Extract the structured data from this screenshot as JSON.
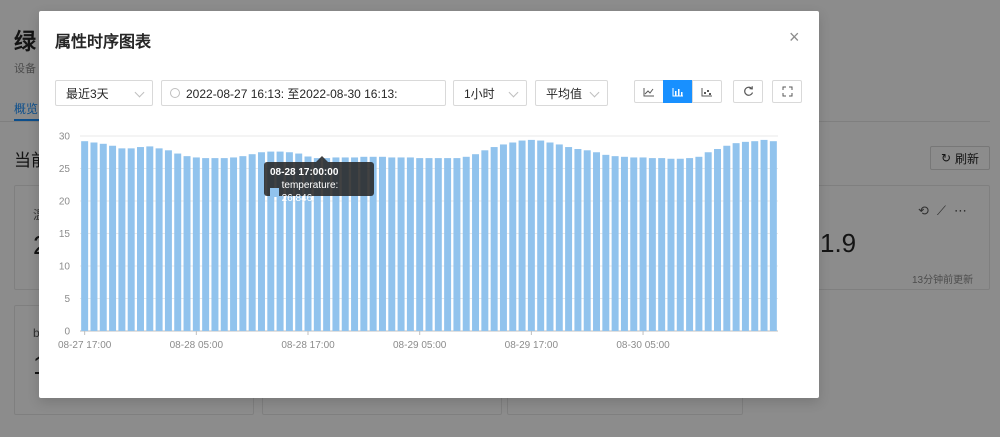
{
  "background": {
    "title": "绿",
    "subtitle": "设备",
    "tab": "概览",
    "section_title": "当前",
    "refresh_label": "刷新",
    "card1_label": "温",
    "card1_value": "2",
    "card2_label": "b",
    "card2_value": "1",
    "right_value": "1.9",
    "right_time": "13分钟前更新"
  },
  "modal": {
    "title": "属性时序图表",
    "close": "×",
    "time_range": "最近3天",
    "date_range": "2022-08-27 16:13:  至2022-08-30 16:13:",
    "interval": "1小时",
    "aggregation": "平均值",
    "chart_types": [
      "line-chart-icon",
      "bar-chart-icon",
      "table-chart-icon"
    ],
    "active_chart_type": "bar-chart-icon"
  },
  "tooltip": {
    "title": "08-28 17:00:00",
    "series": "temperature",
    "value": "26.846",
    "text": "temperature: 26.846"
  },
  "chart_data": {
    "type": "bar",
    "bar_color": "#91c3ed",
    "ylim": [
      0,
      30
    ],
    "yticks": [
      0,
      5,
      10,
      15,
      20,
      25,
      30
    ],
    "x_tick_labels": [
      "08-27 17:00",
      "08-28 05:00",
      "08-28 17:00",
      "08-29 05:00",
      "08-29 17:00",
      "08-30 05:00"
    ],
    "x_tick_every": 12,
    "series": [
      {
        "name": "temperature",
        "values": [
          29.2,
          29.0,
          28.8,
          28.5,
          28.1,
          28.1,
          28.3,
          28.4,
          28.1,
          27.8,
          27.3,
          26.9,
          26.7,
          26.6,
          26.6,
          26.6,
          26.7,
          26.9,
          27.2,
          27.5,
          27.6,
          27.6,
          27.5,
          27.3,
          26.846,
          26.6,
          26.6,
          26.7,
          26.7,
          26.7,
          26.8,
          26.8,
          26.8,
          26.7,
          26.7,
          26.7,
          26.6,
          26.6,
          26.6,
          26.6,
          26.6,
          26.8,
          27.2,
          27.8,
          28.3,
          28.7,
          29.0,
          29.3,
          29.4,
          29.3,
          29.0,
          28.7,
          28.3,
          28.0,
          27.8,
          27.5,
          27.1,
          26.9,
          26.8,
          26.7,
          26.7,
          26.6,
          26.6,
          26.5,
          26.5,
          26.6,
          26.8,
          27.5,
          28.0,
          28.5,
          28.9,
          29.1,
          29.2,
          29.4,
          29.2
        ]
      }
    ]
  }
}
